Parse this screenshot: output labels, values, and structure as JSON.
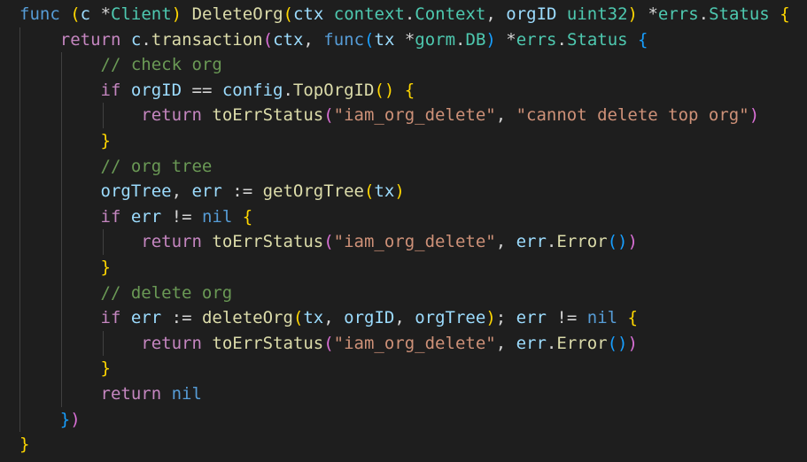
{
  "editor": {
    "language": "go",
    "lines": [
      [
        [
          "kw",
          "func"
        ],
        [
          "p",
          " "
        ],
        [
          "b1",
          "("
        ],
        [
          "var",
          "c"
        ],
        [
          "p",
          " *"
        ],
        [
          "ty",
          "Client"
        ],
        [
          "b1",
          ")"
        ],
        [
          "p",
          " "
        ],
        [
          "fn",
          "DeleteOrg"
        ],
        [
          "b1",
          "("
        ],
        [
          "var",
          "ctx"
        ],
        [
          "p",
          " "
        ],
        [
          "ty",
          "context"
        ],
        [
          "p",
          "."
        ],
        [
          "ty",
          "Context"
        ],
        [
          "p",
          ", "
        ],
        [
          "var",
          "orgID"
        ],
        [
          "p",
          " "
        ],
        [
          "ty",
          "uint32"
        ],
        [
          "b1",
          ")"
        ],
        [
          "p",
          " *"
        ],
        [
          "ty",
          "errs"
        ],
        [
          "p",
          "."
        ],
        [
          "ty",
          "Status"
        ],
        [
          "p",
          " "
        ],
        [
          "b1",
          "{"
        ]
      ],
      [
        [
          "p",
          "    "
        ],
        [
          "ctl",
          "return"
        ],
        [
          "p",
          " "
        ],
        [
          "var",
          "c"
        ],
        [
          "p",
          "."
        ],
        [
          "fn",
          "transaction"
        ],
        [
          "b2",
          "("
        ],
        [
          "var",
          "ctx"
        ],
        [
          "p",
          ", "
        ],
        [
          "kw",
          "func"
        ],
        [
          "b3",
          "("
        ],
        [
          "var",
          "tx"
        ],
        [
          "p",
          " *"
        ],
        [
          "ty",
          "gorm"
        ],
        [
          "p",
          "."
        ],
        [
          "ty",
          "DB"
        ],
        [
          "b3",
          ")"
        ],
        [
          "p",
          " *"
        ],
        [
          "ty",
          "errs"
        ],
        [
          "p",
          "."
        ],
        [
          "ty",
          "Status"
        ],
        [
          "p",
          " "
        ],
        [
          "b3",
          "{"
        ]
      ],
      [
        [
          "p",
          "        "
        ],
        [
          "cm",
          "// check org"
        ]
      ],
      [
        [
          "p",
          "        "
        ],
        [
          "ctl",
          "if"
        ],
        [
          "p",
          " "
        ],
        [
          "var",
          "orgID"
        ],
        [
          "p",
          " == "
        ],
        [
          "var",
          "config"
        ],
        [
          "p",
          "."
        ],
        [
          "fn",
          "TopOrgID"
        ],
        [
          "b1",
          "()"
        ],
        [
          "p",
          " "
        ],
        [
          "b1",
          "{"
        ]
      ],
      [
        [
          "p",
          "            "
        ],
        [
          "ctl",
          "return"
        ],
        [
          "p",
          " "
        ],
        [
          "fn",
          "toErrStatus"
        ],
        [
          "b2",
          "("
        ],
        [
          "str",
          "\"iam_org_delete\""
        ],
        [
          "p",
          ", "
        ],
        [
          "str",
          "\"cannot delete top org\""
        ],
        [
          "b2",
          ")"
        ]
      ],
      [
        [
          "p",
          "        "
        ],
        [
          "b1",
          "}"
        ]
      ],
      [
        [
          "p",
          "        "
        ],
        [
          "cm",
          "// org tree"
        ]
      ],
      [
        [
          "p",
          "        "
        ],
        [
          "var",
          "orgTree"
        ],
        [
          "p",
          ", "
        ],
        [
          "var",
          "err"
        ],
        [
          "p",
          " := "
        ],
        [
          "fn",
          "getOrgTree"
        ],
        [
          "b1",
          "("
        ],
        [
          "var",
          "tx"
        ],
        [
          "b1",
          ")"
        ]
      ],
      [
        [
          "p",
          "        "
        ],
        [
          "ctl",
          "if"
        ],
        [
          "p",
          " "
        ],
        [
          "var",
          "err"
        ],
        [
          "p",
          " != "
        ],
        [
          "kw",
          "nil"
        ],
        [
          "p",
          " "
        ],
        [
          "b1",
          "{"
        ]
      ],
      [
        [
          "p",
          "            "
        ],
        [
          "ctl",
          "return"
        ],
        [
          "p",
          " "
        ],
        [
          "fn",
          "toErrStatus"
        ],
        [
          "b2",
          "("
        ],
        [
          "str",
          "\"iam_org_delete\""
        ],
        [
          "p",
          ", "
        ],
        [
          "var",
          "err"
        ],
        [
          "p",
          "."
        ],
        [
          "fn",
          "Error"
        ],
        [
          "b3",
          "()"
        ],
        [
          "b2",
          ")"
        ]
      ],
      [
        [
          "p",
          "        "
        ],
        [
          "b1",
          "}"
        ]
      ],
      [
        [
          "p",
          "        "
        ],
        [
          "cm",
          "// delete org"
        ]
      ],
      [
        [
          "p",
          "        "
        ],
        [
          "ctl",
          "if"
        ],
        [
          "p",
          " "
        ],
        [
          "var",
          "err"
        ],
        [
          "p",
          " := "
        ],
        [
          "fn",
          "deleteOrg"
        ],
        [
          "b1",
          "("
        ],
        [
          "var",
          "tx"
        ],
        [
          "p",
          ", "
        ],
        [
          "var",
          "orgID"
        ],
        [
          "p",
          ", "
        ],
        [
          "var",
          "orgTree"
        ],
        [
          "b1",
          ")"
        ],
        [
          "p",
          "; "
        ],
        [
          "var",
          "err"
        ],
        [
          "p",
          " != "
        ],
        [
          "kw",
          "nil"
        ],
        [
          "p",
          " "
        ],
        [
          "b1",
          "{"
        ]
      ],
      [
        [
          "p",
          "            "
        ],
        [
          "ctl",
          "return"
        ],
        [
          "p",
          " "
        ],
        [
          "fn",
          "toErrStatus"
        ],
        [
          "b2",
          "("
        ],
        [
          "str",
          "\"iam_org_delete\""
        ],
        [
          "p",
          ", "
        ],
        [
          "var",
          "err"
        ],
        [
          "p",
          "."
        ],
        [
          "fn",
          "Error"
        ],
        [
          "b3",
          "()"
        ],
        [
          "b2",
          ")"
        ]
      ],
      [
        [
          "p",
          "        "
        ],
        [
          "b1",
          "}"
        ]
      ],
      [
        [
          "p",
          "        "
        ],
        [
          "ctl",
          "return"
        ],
        [
          "p",
          " "
        ],
        [
          "kw",
          "nil"
        ]
      ],
      [
        [
          "p",
          "    "
        ],
        [
          "b3",
          "}"
        ],
        [
          "b2",
          ")"
        ]
      ],
      [
        [
          "b1",
          "}"
        ]
      ]
    ],
    "guides": [
      [],
      [
        1
      ],
      [
        1,
        2
      ],
      [
        1,
        2
      ],
      [
        1,
        2,
        3
      ],
      [
        1,
        2
      ],
      [
        1,
        2
      ],
      [
        1,
        2
      ],
      [
        1,
        2
      ],
      [
        1,
        2,
        3
      ],
      [
        1,
        2
      ],
      [
        1,
        2
      ],
      [
        1,
        2
      ],
      [
        1,
        2,
        3
      ],
      [
        1,
        2
      ],
      [
        1,
        2
      ],
      [
        1
      ],
      []
    ]
  }
}
